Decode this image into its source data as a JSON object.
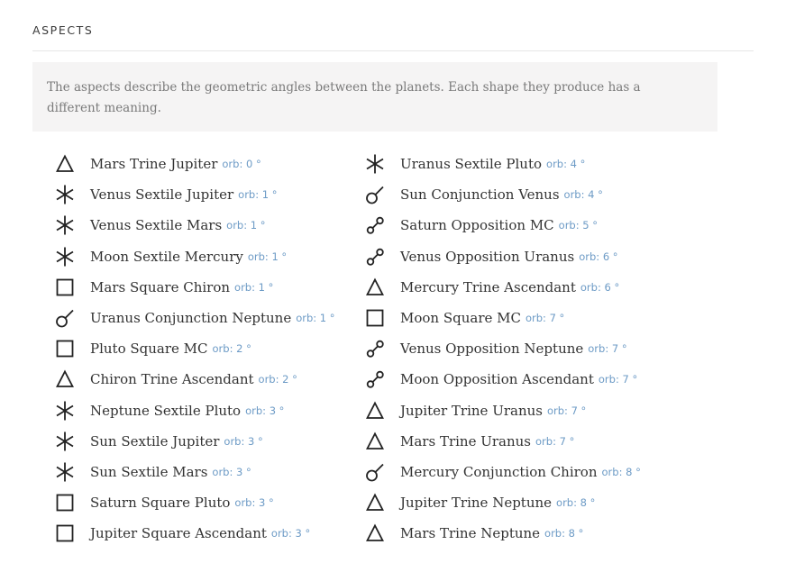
{
  "section": {
    "title": "ASPECTS",
    "description": "The aspects describe the geometric angles between the planets. Each shape they produce has a different meaning."
  },
  "colors": {
    "orb_text": "#6d9bc6",
    "info_background": "#f5f4f4",
    "body_text": "#333333"
  },
  "aspects_left": [
    {
      "name": "Mars Trine Jupiter",
      "orb": "orb: 0 °",
      "icon": "trine-icon"
    },
    {
      "name": "Venus Sextile Jupiter",
      "orb": "orb: 1 °",
      "icon": "sextile-icon"
    },
    {
      "name": "Venus Sextile Mars",
      "orb": "orb: 1 °",
      "icon": "sextile-icon"
    },
    {
      "name": "Moon Sextile Mercury",
      "orb": "orb: 1 °",
      "icon": "sextile-icon"
    },
    {
      "name": "Mars Square Chiron",
      "orb": "orb: 1 °",
      "icon": "square-icon"
    },
    {
      "name": "Uranus Conjunction Neptune",
      "orb": "orb: 1 °",
      "icon": "conjunction-icon"
    },
    {
      "name": "Pluto Square MC",
      "orb": "orb: 2 °",
      "icon": "square-icon"
    },
    {
      "name": "Chiron Trine Ascendant",
      "orb": "orb: 2 °",
      "icon": "trine-icon"
    },
    {
      "name": "Neptune Sextile Pluto",
      "orb": "orb: 3 °",
      "icon": "sextile-icon"
    },
    {
      "name": "Sun Sextile Jupiter",
      "orb": "orb: 3 °",
      "icon": "sextile-icon"
    },
    {
      "name": "Sun Sextile Mars",
      "orb": "orb: 3 °",
      "icon": "sextile-icon"
    },
    {
      "name": "Saturn Square Pluto",
      "orb": "orb: 3 °",
      "icon": "square-icon"
    },
    {
      "name": "Jupiter Square Ascendant",
      "orb": "orb: 3 °",
      "icon": "square-icon"
    }
  ],
  "aspects_right": [
    {
      "name": "Uranus Sextile Pluto",
      "orb": "orb: 4 °",
      "icon": "sextile-icon"
    },
    {
      "name": "Sun Conjunction Venus",
      "orb": "orb: 4 °",
      "icon": "conjunction-icon"
    },
    {
      "name": "Saturn Opposition MC",
      "orb": "orb: 5 °",
      "icon": "opposition-icon"
    },
    {
      "name": "Venus Opposition Uranus",
      "orb": "orb: 6 °",
      "icon": "opposition-icon"
    },
    {
      "name": "Mercury Trine Ascendant",
      "orb": "orb: 6 °",
      "icon": "trine-icon"
    },
    {
      "name": "Moon Square MC",
      "orb": "orb: 7 °",
      "icon": "square-icon"
    },
    {
      "name": "Venus Opposition Neptune",
      "orb": "orb: 7 °",
      "icon": "opposition-icon"
    },
    {
      "name": "Moon Opposition Ascendant",
      "orb": "orb: 7 °",
      "icon": "opposition-icon"
    },
    {
      "name": "Jupiter Trine Uranus",
      "orb": "orb: 7 °",
      "icon": "trine-icon"
    },
    {
      "name": "Mars Trine Uranus",
      "orb": "orb: 7 °",
      "icon": "trine-icon"
    },
    {
      "name": "Mercury Conjunction Chiron",
      "orb": "orb: 8 °",
      "icon": "conjunction-icon"
    },
    {
      "name": "Jupiter Trine Neptune",
      "orb": "orb: 8 °",
      "icon": "trine-icon"
    },
    {
      "name": "Mars Trine Neptune",
      "orb": "orb: 8 °",
      "icon": "trine-icon"
    }
  ]
}
